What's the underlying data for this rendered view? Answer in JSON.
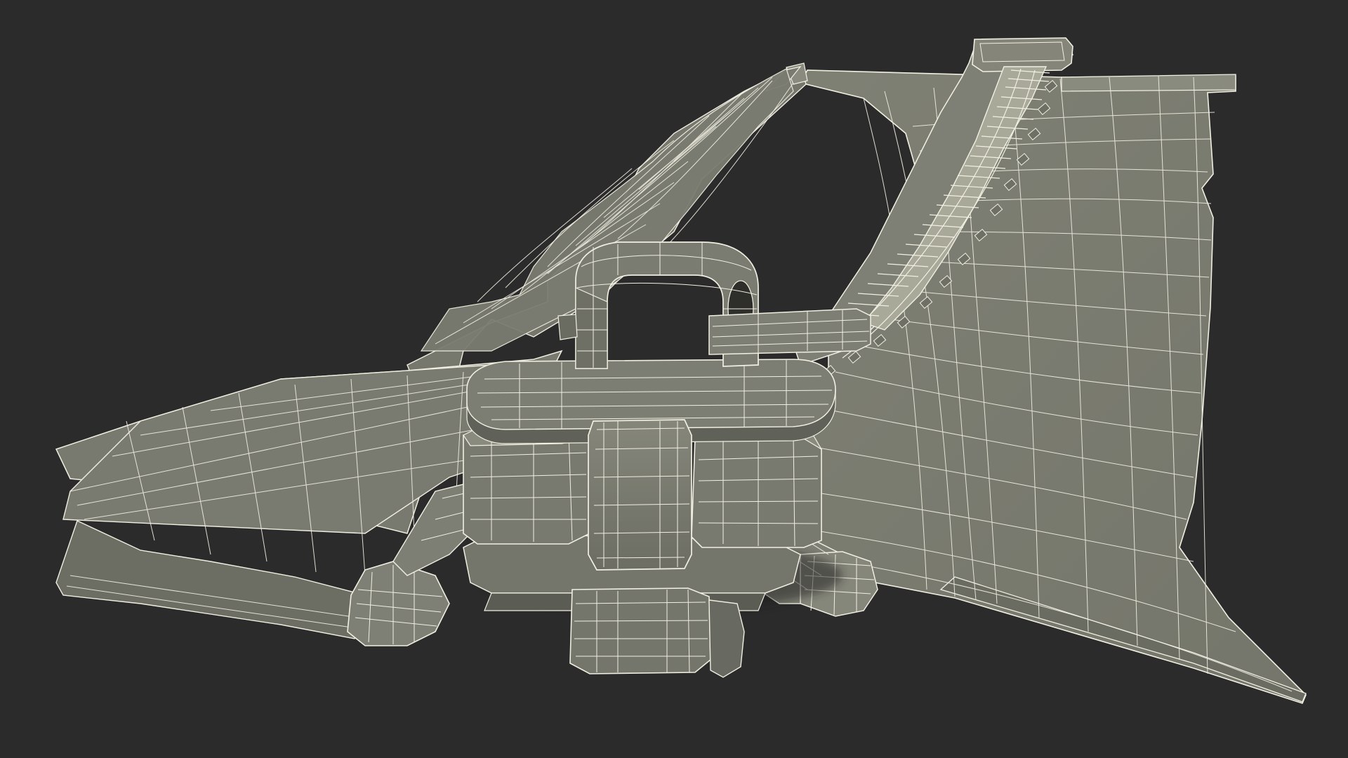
{
  "render": {
    "background_color": "#2b2b2b",
    "surface_color": "#7b7c72",
    "surface_light_color": "#868779",
    "surface_shadow_color": "#55574f",
    "dark_shadow_color": "#3a3b36",
    "wire_color": "#f1efe2",
    "subject": "zipper-wireframe-model"
  }
}
